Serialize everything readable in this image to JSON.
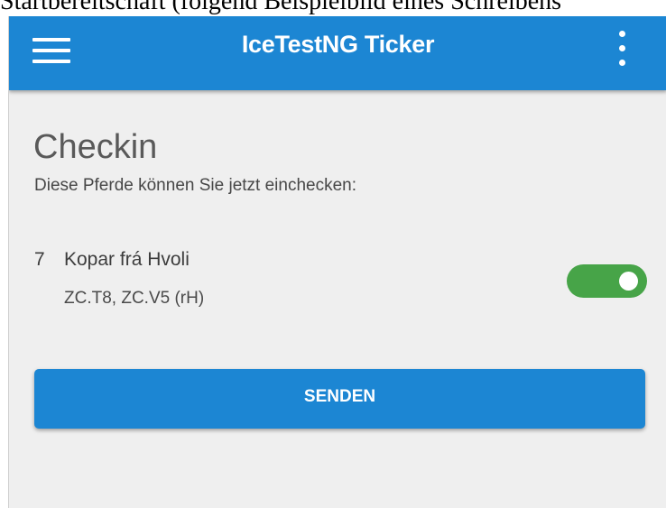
{
  "document_caption": "Startbereitschaft (folgend Beispielbild eines Schreibens",
  "app": {
    "title": "IceTestNG Ticker",
    "menu_icon": "hamburger-menu-icon",
    "more_icon": "more-vertical-icon",
    "accent_color": "#1c86d3"
  },
  "checkin": {
    "title": "Checkin",
    "subtitle": "Diese Pferde können Sie jetzt einchecken:",
    "entries": [
      {
        "number": "7",
        "name": "Kopar frá Hvoli",
        "classes": "ZC.T8, ZC.V5 (rH)",
        "checked_in": true,
        "toggle_color": "#47a448"
      }
    ],
    "send_label": "SENDEN"
  }
}
